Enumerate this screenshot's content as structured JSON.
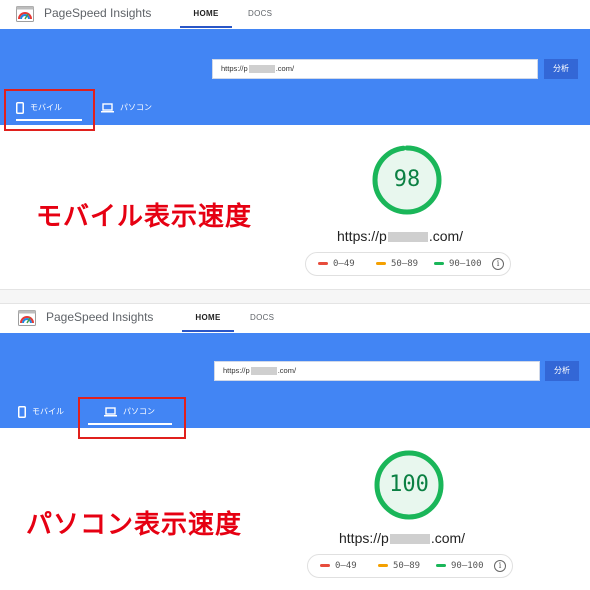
{
  "panels": [
    {
      "header": {
        "brand": "PageSpeed Insights",
        "nav": [
          {
            "label": "HOME",
            "active": true
          },
          {
            "label": "DOCS",
            "active": false
          }
        ]
      },
      "search": {
        "url_prefix": "https://p",
        "url_suffix": ".com/",
        "analyze_label": "分析"
      },
      "tabs": [
        {
          "label": "モバイル",
          "active": true,
          "icon": "smartphone-icon"
        },
        {
          "label": "パソコン",
          "active": false,
          "icon": "laptop-icon"
        }
      ],
      "highlighted_tab": "モバイル",
      "score": "98",
      "score_value": 98,
      "tested_url_prefix": "https://p",
      "tested_url_suffix": ".com/",
      "caption": "モバイル表示速度",
      "legend": [
        {
          "range": "0–49",
          "color": "#e74c3c"
        },
        {
          "range": "50–89",
          "color": "#f4a000"
        },
        {
          "range": "90–100",
          "color": "#1ab659"
        }
      ]
    },
    {
      "header": {
        "brand": "PageSpeed Insights",
        "nav": [
          {
            "label": "HOME",
            "active": true
          },
          {
            "label": "DOCS",
            "active": false
          }
        ]
      },
      "search": {
        "url_prefix": "https://p",
        "url_suffix": ".com/",
        "analyze_label": "分析"
      },
      "tabs": [
        {
          "label": "モバイル",
          "active": false,
          "icon": "smartphone-icon"
        },
        {
          "label": "パソコン",
          "active": true,
          "icon": "laptop-icon"
        }
      ],
      "highlighted_tab": "パソコン",
      "score": "100",
      "score_value": 100,
      "tested_url_prefix": "https://p",
      "tested_url_suffix": ".com/",
      "caption": "パソコン表示速度",
      "legend": [
        {
          "range": "0–49",
          "color": "#e74c3c"
        },
        {
          "range": "50–89",
          "color": "#f4a000"
        },
        {
          "range": "90–100",
          "color": "#1ab659"
        }
      ]
    }
  ],
  "colors": {
    "header_blue": "#4285f4",
    "analyze_button": "#3367d6",
    "score_green": "#1ab659",
    "caption_red": "#e60012",
    "highlight_red": "#e0201c"
  }
}
